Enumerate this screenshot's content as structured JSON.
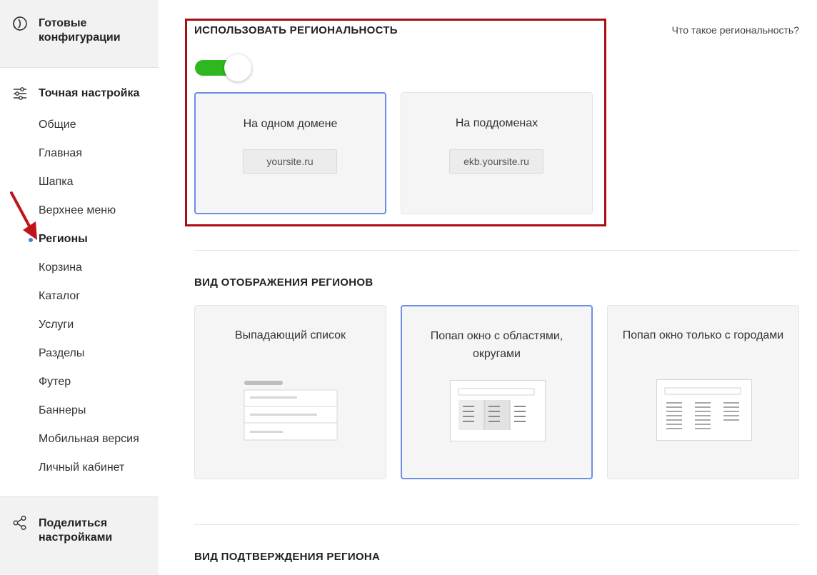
{
  "sidebar": {
    "ready_configs": "Готовые конфигурации",
    "fine_tune": "Точная настройка",
    "items": [
      {
        "label": "Общие"
      },
      {
        "label": "Главная"
      },
      {
        "label": "Шапка"
      },
      {
        "label": "Верхнее меню"
      },
      {
        "label": "Регионы"
      },
      {
        "label": "Корзина"
      },
      {
        "label": "Каталог"
      },
      {
        "label": "Услуги"
      },
      {
        "label": "Разделы"
      },
      {
        "label": "Футер"
      },
      {
        "label": "Баннеры"
      },
      {
        "label": "Мобильная версия"
      },
      {
        "label": "Личный кабинет"
      }
    ],
    "active_index": 4,
    "share_settings": "Поделиться настройками"
  },
  "regionality": {
    "title": "ИСПОЛЬЗОВАТЬ РЕГИОНАЛЬНОСТЬ",
    "help_link": "Что такое региональность?",
    "toggle_on": true,
    "options": [
      {
        "label": "На одном домене",
        "domain": "yoursite.ru",
        "selected": true
      },
      {
        "label": "На поддоменах",
        "domain": "ekb.yoursite.ru",
        "selected": false
      }
    ]
  },
  "display": {
    "title": "ВИД ОТОБРАЖЕНИЯ РЕГИОНОВ",
    "options": [
      {
        "label": "Выпадающий список",
        "selected": false
      },
      {
        "label": "Попап окно с областями, округами",
        "selected": true
      },
      {
        "label": "Попап окно только с городами",
        "selected": false
      }
    ]
  },
  "confirm": {
    "title": "ВИД ПОДТВЕРЖДЕНИЯ РЕГИОНА"
  },
  "colors": {
    "accent": "#4b7bec",
    "toggle_on": "#2eb81f",
    "highlight": "#a80d12",
    "selected_border": "#6b8ee6"
  }
}
